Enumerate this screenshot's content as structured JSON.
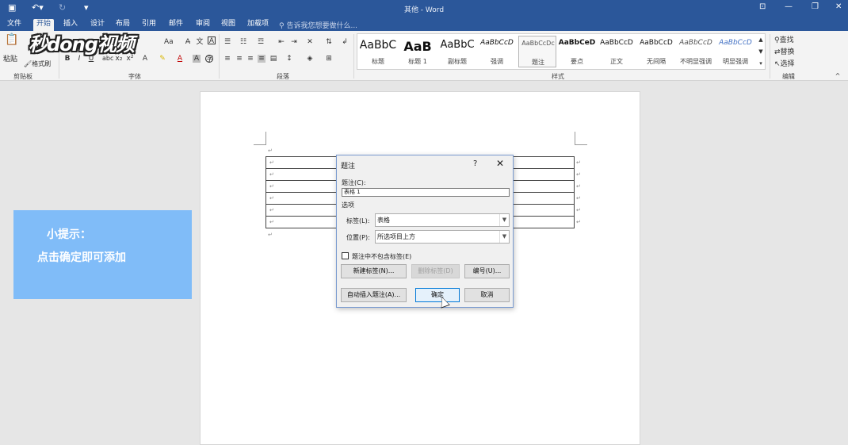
{
  "titlebar": {
    "title": "其他 - Word"
  },
  "tabs": [
    {
      "label": "文件"
    },
    {
      "label": "开始"
    },
    {
      "label": "插入"
    },
    {
      "label": "设计"
    },
    {
      "label": "布局"
    },
    {
      "label": "引用"
    },
    {
      "label": "邮件"
    },
    {
      "label": "审阅"
    },
    {
      "label": "视图"
    },
    {
      "label": "加载项"
    }
  ],
  "tell_me": {
    "placeholder": "告诉我您想要做什么..."
  },
  "ribbon": {
    "clipboard": {
      "paste": "粘贴",
      "format_painter": "格式刷",
      "label": "剪贴板"
    },
    "font": {
      "label": "字体",
      "aa": "Aa"
    },
    "paragraph": {
      "label": "段落"
    },
    "styles": {
      "label": "样式",
      "items": [
        {
          "sample": "AaBbC",
          "name": "标题"
        },
        {
          "sample": "AaB",
          "name": "标题 1"
        },
        {
          "sample": "AaBbC",
          "name": "副标题"
        },
        {
          "sample": "AaBbCcD",
          "name": "强调"
        },
        {
          "sample": "AaBbCcDc",
          "name": "题注"
        },
        {
          "sample": "AaBbCeD",
          "name": "要点"
        },
        {
          "sample": "AaBbCcD",
          "name": "正文"
        },
        {
          "sample": "AaBbCcD",
          "name": "无间隔"
        },
        {
          "sample": "AaBbCcD",
          "name": "不明显强调"
        },
        {
          "sample": "AaBbCcD",
          "name": "明显强调"
        }
      ]
    },
    "editing": {
      "find": "查找",
      "replace": "替换",
      "select": "选择",
      "label": "编辑"
    }
  },
  "logo": {
    "text": "秒dong视频"
  },
  "tip": {
    "line1": "小提示：",
    "line2": "点击确定即可添加"
  },
  "dialog": {
    "title": "题注",
    "help": "?",
    "caption_label": "题注(C):",
    "caption_value": "表格 1",
    "options_label": "选项",
    "tag_label": "标签(L):",
    "tag_value": "表格",
    "position_label": "位置(P):",
    "position_value": "所选项目上方",
    "exclude_label": "题注中不包含标签(E)",
    "new_label_button": "新建标签(N)...",
    "delete_label_button": "删除标签(D)",
    "numbering_button": "编号(U)...",
    "auto_insert_button": "自动插入题注(A)...",
    "ok_button": "确定",
    "cancel_button": "取消"
  },
  "doc": {
    "para": "↵"
  }
}
